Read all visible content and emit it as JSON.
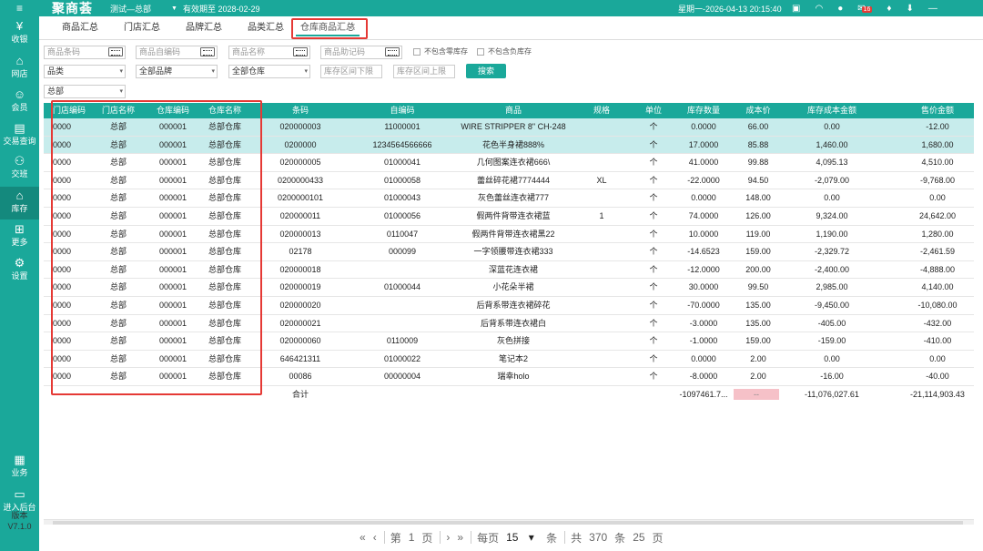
{
  "topbar": {
    "menu_icon": "hamburger-icon",
    "logo": "聚商荟",
    "store": "测试—总部",
    "expire": "有效期至 2028-02-29",
    "datetime": "星期一-2026-04-13 20:15:40",
    "badge": "16"
  },
  "sidebar": {
    "items": [
      {
        "label": "收银",
        "icon": "yen-icon"
      },
      {
        "label": "网店",
        "icon": "shop-icon"
      },
      {
        "label": "会员",
        "icon": "user-icon"
      },
      {
        "label": "交易查询",
        "icon": "document-icon"
      },
      {
        "label": "交班",
        "icon": "handover-icon"
      },
      {
        "label": "库存",
        "icon": "warehouse-icon"
      },
      {
        "label": "更多",
        "icon": "more-icon"
      },
      {
        "label": "设置",
        "icon": "gear-icon"
      },
      {
        "label": "业务",
        "icon": "business-icon"
      },
      {
        "label": "进入后台",
        "icon": "backend-icon"
      }
    ],
    "version_label": "版本",
    "version": "V7.1.0"
  },
  "tabs": [
    {
      "label": "商品汇总"
    },
    {
      "label": "门店汇总"
    },
    {
      "label": "品牌汇总"
    },
    {
      "label": "品类汇总"
    },
    {
      "label": "仓库商品汇总"
    }
  ],
  "filters": {
    "barcode_ph": "商品条码",
    "selfcode_ph": "商品自编码",
    "name_ph": "商品名称",
    "mnemonic_ph": "商品助记码",
    "exclude_zero": "不包含零库存",
    "exclude_negative": "不包含负库存",
    "category": "品类",
    "brand": "全部品牌",
    "warehouse": "全部仓库",
    "range_low_ph": "库存区间下限",
    "range_high_ph": "库存区间上限",
    "search_btn": "搜索",
    "store": "总部"
  },
  "table": {
    "headers": [
      "门店编码",
      "门店名称",
      "仓库编码",
      "仓库名称",
      "条码",
      "自编码",
      "商品",
      "规格",
      "单位",
      "库存数量",
      "成本价",
      "库存成本金额",
      "售价金额"
    ],
    "rows": [
      [
        "0000",
        "总部",
        "000001",
        "总部仓库",
        "020000003",
        "11000001",
        "WIRE STRIPPER 8\" CH-248",
        "",
        "个",
        "0.0000",
        "66.00",
        "0.00",
        "-12.00"
      ],
      [
        "0000",
        "总部",
        "000001",
        "总部仓库",
        "0200000",
        "1234564566666",
        "花色半身裙888%",
        "",
        "个",
        "17.0000",
        "85.88",
        "1,460.00",
        "1,680.00"
      ],
      [
        "0000",
        "总部",
        "000001",
        "总部仓库",
        "020000005",
        "01000041",
        "几何图案连衣裙666\\",
        "",
        "个",
        "41.0000",
        "99.88",
        "4,095.13",
        "4,510.00"
      ],
      [
        "0000",
        "总部",
        "000001",
        "总部仓库",
        "0200000433",
        "01000058",
        "蕾丝碎花裙7774444",
        "XL",
        "个",
        "-22.0000",
        "94.50",
        "-2,079.00",
        "-9,768.00"
      ],
      [
        "0000",
        "总部",
        "000001",
        "总部仓库",
        "0200000101",
        "01000043",
        "灰色蕾丝连衣裙777",
        "",
        "个",
        "0.0000",
        "148.00",
        "0.00",
        "0.00"
      ],
      [
        "0000",
        "总部",
        "000001",
        "总部仓库",
        "020000011",
        "01000056",
        "假两件背带连衣裙蓝",
        "1",
        "个",
        "74.0000",
        "126.00",
        "9,324.00",
        "24,642.00"
      ],
      [
        "0000",
        "总部",
        "000001",
        "总部仓库",
        "020000013",
        "0110047",
        "假两件背带连衣裙黑22",
        "",
        "个",
        "10.0000",
        "119.00",
        "1,190.00",
        "1,280.00"
      ],
      [
        "0000",
        "总部",
        "000001",
        "总部仓库",
        "02178",
        "000099",
        "一字领腰带连衣裙333",
        "",
        "个",
        "-14.6523",
        "159.00",
        "-2,329.72",
        "-2,461.59"
      ],
      [
        "0000",
        "总部",
        "000001",
        "总部仓库",
        "020000018",
        "",
        "深蓝花连衣裙",
        "",
        "个",
        "-12.0000",
        "200.00",
        "-2,400.00",
        "-4,888.00"
      ],
      [
        "0000",
        "总部",
        "000001",
        "总部仓库",
        "020000019",
        "01000044",
        "小花朵半裙",
        "",
        "个",
        "30.0000",
        "99.50",
        "2,985.00",
        "4,140.00"
      ],
      [
        "0000",
        "总部",
        "000001",
        "总部仓库",
        "020000020",
        "",
        "后背系带连衣裙碎花",
        "",
        "个",
        "-70.0000",
        "135.00",
        "-9,450.00",
        "-10,080.00"
      ],
      [
        "0000",
        "总部",
        "000001",
        "总部仓库",
        "020000021",
        "",
        "后背系带连衣裙白",
        "",
        "个",
        "-3.0000",
        "135.00",
        "-405.00",
        "-432.00"
      ],
      [
        "0000",
        "总部",
        "000001",
        "总部仓库",
        "020000060",
        "0110009",
        "灰色拼接",
        "",
        "个",
        "-1.0000",
        "159.00",
        "-159.00",
        "-410.00"
      ],
      [
        "0000",
        "总部",
        "000001",
        "总部仓库",
        "646421311",
        "01000022",
        "笔记本2",
        "",
        "个",
        "0.0000",
        "2.00",
        "0.00",
        "0.00"
      ],
      [
        "0000",
        "总部",
        "000001",
        "总部仓库",
        "00086",
        "00000004",
        "瑞幸holo",
        "",
        "个",
        "-8.0000",
        "2.00",
        "-16.00",
        "-40.00"
      ]
    ],
    "total": {
      "label": "合计",
      "qty": "-1097461.7...",
      "cost": "--",
      "amount": "-11,076,027.61",
      "sale": "-21,114,903.43"
    }
  },
  "pager": {
    "first": "«",
    "prev": "‹",
    "page_prefix": "第",
    "page": "1",
    "page_suffix": "页",
    "next": "›",
    "last": "»",
    "per_page_label": "每页",
    "per_page": "15",
    "per_page_unit": "条",
    "total_prefix": "共",
    "total_count": "370",
    "total_unit": "条",
    "pages": "25",
    "pages_unit": "页"
  }
}
